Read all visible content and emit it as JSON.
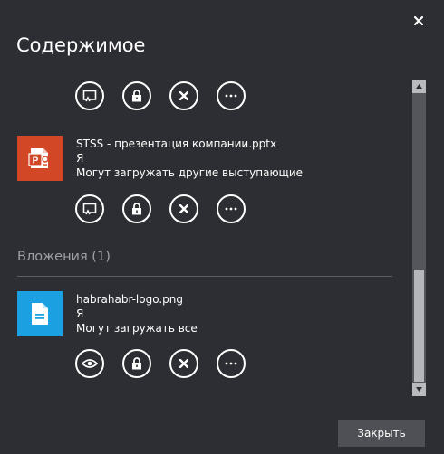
{
  "dialog": {
    "title": "Содержимое",
    "close_button_label": "Закрыть"
  },
  "colors": {
    "background": "#2d2e33",
    "pptx_tile": "#d24726",
    "png_tile": "#1ba1e2",
    "muted_text": "#9fa0a6"
  },
  "files": [
    {
      "name": "STSS - презентация компании.pptx",
      "owner": "Я",
      "permission": "Могут загружать другие выступающие",
      "icon": "powerpoint-icon"
    }
  ],
  "attachments": {
    "heading": "Вложения (1)",
    "items": [
      {
        "name": "habrahabr-logo.png",
        "owner": "Я",
        "permission": "Могут загружать все",
        "icon": "document-icon"
      }
    ]
  },
  "actions": {
    "icons": [
      "present-icon",
      "lock-icon",
      "remove-icon",
      "more-icon",
      "view-icon"
    ]
  }
}
